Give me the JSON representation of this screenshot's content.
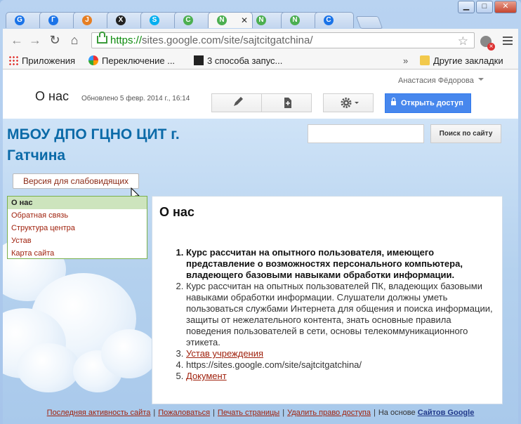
{
  "browser": {
    "tabs": [
      {
        "icon": "chrome-icon",
        "label": "G",
        "color": "#1a73e8"
      },
      {
        "icon": "chrome-icon",
        "label": "Г",
        "color": "#1a73e8"
      },
      {
        "icon": "joomla-icon",
        "label": "J",
        "color": "#e67e22"
      },
      {
        "icon": "x-icon",
        "label": "Х",
        "color": "#222"
      },
      {
        "icon": "skype-icon",
        "label": "S",
        "color": "#00aff0"
      },
      {
        "icon": "sites-icon",
        "label": "С",
        "color": "#4caf50"
      },
      {
        "icon": "sites-icon",
        "label": "N",
        "color": "#4caf50",
        "active": true
      },
      {
        "icon": "sites-icon",
        "label": "N",
        "color": "#4caf50"
      },
      {
        "icon": "sites-icon",
        "label": "N",
        "color": "#4caf50"
      },
      {
        "icon": "chrome-icon",
        "label": "С",
        "color": "#1a73e8"
      }
    ],
    "url_https": "https://",
    "url_rest": "sites.google.com/site/sajtcitgatchina/",
    "bookmarks": {
      "apps": "Приложения",
      "item1": "Переключение ...",
      "item2": "3 способа запус...",
      "more": "»",
      "other": "Другие закладки"
    }
  },
  "header": {
    "user": "Анастасия Фёдорова",
    "page_title": "О нас",
    "updated": "Обновлено 5 февр. 2014 г., 16:14",
    "share_label": "Открыть доступ"
  },
  "site": {
    "title": "МБОУ ДПО ГЦНО ЦИТ г. Гатчина",
    "search_button": "Поиск по сайту",
    "search_placeholder": "",
    "accessibility_button": "Версия для слабовидящих",
    "nav": [
      "О нас",
      "Обратная связь",
      "Структура центра",
      "Устав",
      "Карта сайта"
    ]
  },
  "content": {
    "heading": "О нас",
    "items": [
      "Курс рассчитан на опытного пользователя, имеющего представление о возможностях персонального компьютера, владеющего базовыми навыками обработки информации.",
      "Курс рассчитан на опытных пользователей ПК, владеющих базовыми навыками обработки информации. Слушатели должны уметь пользоваться службами Интернета для общения и поиска информации, защиты от нежелательного контента, знать основные правила поведения пользователей в сети, основы телекоммуникационного этикета.",
      "Устав учреждения",
      "https://sites.google.com/site/sajtcitgatchina/",
      "Документ"
    ]
  },
  "footer": {
    "activity": "Последняя активность сайта",
    "report": "Пожаловаться",
    "print": "Печать страницы",
    "remove": "Удалить право доступа",
    "powered": "На основе",
    "sites": "Сайтов Google"
  },
  "colors": {
    "site_title": "#0b6aa8",
    "link": "#a0220e",
    "share_button": "#4787ed",
    "nav_selected": "#cde4bd"
  }
}
